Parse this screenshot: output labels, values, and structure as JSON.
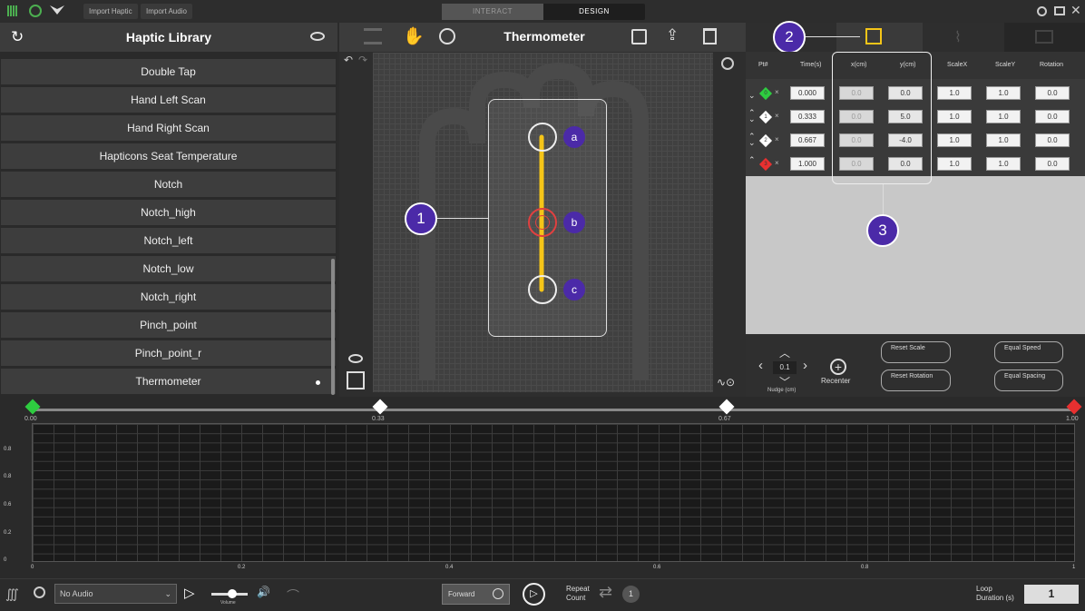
{
  "topbar": {
    "import_haptic": "Import Haptic",
    "import_audio": "Import Audio",
    "mode_interact": "INTERACT",
    "mode_design": "DESIGN"
  },
  "library": {
    "title": "Haptic Library",
    "items": [
      "Double Tap",
      "Hand Left Scan",
      "Hand Right Scan",
      "Hapticons Seat Temperature",
      "Notch",
      "Notch_high",
      "Notch_left",
      "Notch_low",
      "Notch_right",
      "Pinch_point",
      "Pinch_point_r",
      "Thermometer"
    ],
    "selected": "Thermometer"
  },
  "center": {
    "title": "Thermometer"
  },
  "callouts": {
    "c1": "1",
    "c2": "2",
    "c3": "3",
    "pa": "a",
    "pb": "b",
    "pc": "c"
  },
  "table": {
    "headers": [
      "Pt#",
      "Time(s)",
      "x(cm)",
      "y(cm)",
      "ScaleX",
      "ScaleY",
      "Rotation"
    ],
    "rows": [
      {
        "pt": "0",
        "time": "0.000",
        "x": "0.0",
        "y": "0.0",
        "sx": "1.0",
        "sy": "1.0",
        "rot": "0.0",
        "color": "#2ecc40"
      },
      {
        "pt": "1",
        "time": "0.333",
        "x": "0.0",
        "y": "5.0",
        "sx": "1.0",
        "sy": "1.0",
        "rot": "0.0",
        "color": "#ffffff"
      },
      {
        "pt": "2",
        "time": "0.667",
        "x": "0.0",
        "y": "-4.0",
        "sx": "1.0",
        "sy": "1.0",
        "rot": "0.0",
        "color": "#ffffff"
      },
      {
        "pt": "3",
        "time": "1.000",
        "x": "0.0",
        "y": "0.0",
        "sx": "1.0",
        "sy": "1.0",
        "rot": "0.0",
        "color": "#e83030"
      }
    ]
  },
  "controls": {
    "nudge_value": "0.1",
    "nudge_label": "Nudge (cm)",
    "recenter": "Recenter",
    "reset_scale": "Reset Scale",
    "reset_rotation": "Reset Rotation",
    "equal_speed": "Equal Speed",
    "equal_spacing": "Equal Spacing"
  },
  "timeline": {
    "keyframes": [
      "0.00",
      "0.33",
      "0.67",
      "1.00"
    ],
    "y_ticks": [
      "0.8",
      "0.8",
      "0.6",
      "0.4",
      "0.2",
      "0"
    ],
    "x_ticks": [
      "0",
      "0.2",
      "0.4",
      "0.6",
      "0.8",
      "1"
    ]
  },
  "bottom": {
    "audio_select": "No Audio",
    "volume_label": "Volume",
    "direction": "Forward",
    "repeat_label": "Repeat Count",
    "repeat_count": "1",
    "loop_label": "Loop Duration (s)",
    "loop_value": "1"
  },
  "colors": {
    "accent": "#4b2aa8",
    "path": "#f5c518",
    "design_tab": "#f5c518"
  }
}
